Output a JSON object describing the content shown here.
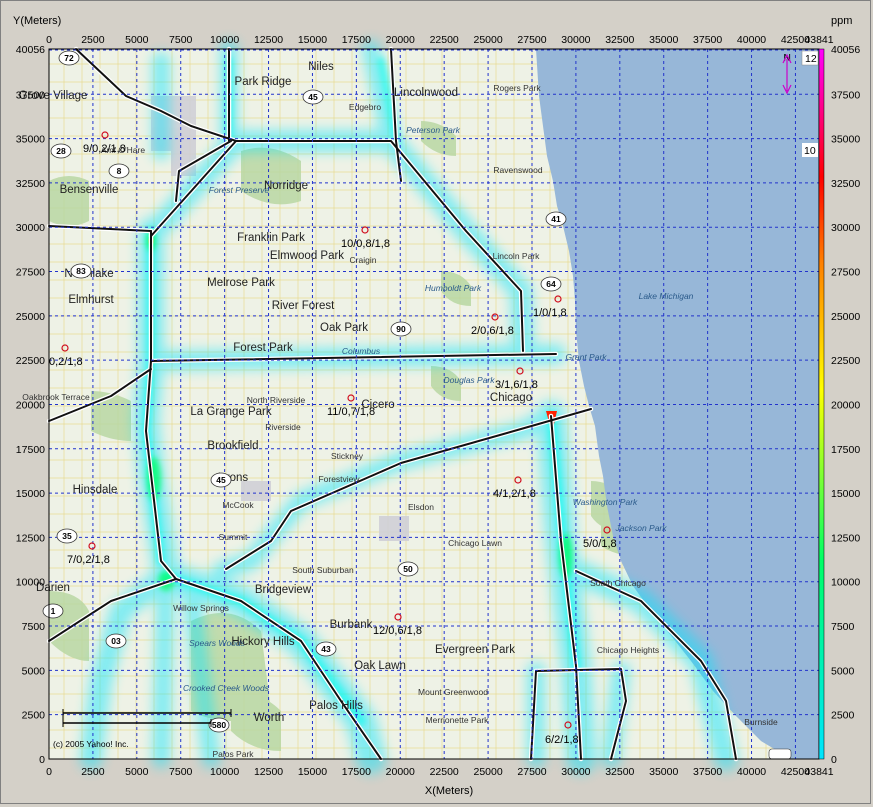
{
  "chart": {
    "y_title": "Y(Meters)",
    "x_title": "X(Meters)",
    "legend_unit": "ppm",
    "x_ticks": [
      "0",
      "2500",
      "5000",
      "7500",
      "10000",
      "12500",
      "15000",
      "17500",
      "20000",
      "22500",
      "25000",
      "27500",
      "30000",
      "32500",
      "35000",
      "37500",
      "40000",
      "42500"
    ],
    "x_end_tick": "43841",
    "y_ticks": [
      "40056",
      "37500",
      "35000",
      "32500",
      "30000",
      "27500",
      "25000",
      "22500",
      "20000",
      "17500",
      "15000",
      "12500",
      "10000",
      "7500",
      "5000",
      "2500",
      "0"
    ],
    "legend_ticks": [
      "40056",
      "37500",
      "35000",
      "32500",
      "30000",
      "27500",
      "25000",
      "22500",
      "20000",
      "17500",
      "15000",
      "12500",
      "10000",
      "7500",
      "5000",
      "2500",
      "0"
    ],
    "colors": {
      "grid": "#2233cc",
      "lake": "#97b7d8",
      "land": "#eef2e6",
      "highway": "#111111",
      "plume_low": "#00e5ff",
      "plume_mid": "#00ff66",
      "plume_high": "#ff2200"
    },
    "legend_colors": [
      "#00e5ff",
      "#00ff66",
      "#ffff00",
      "#ff7f00",
      "#ff0000",
      "#ff00ff"
    ]
  },
  "map_labels": [
    {
      "text": "Niles",
      "cls": "place"
    },
    {
      "text": "Park Ridge",
      "cls": "place"
    },
    {
      "text": "Lincolnwood",
      "cls": "place"
    },
    {
      "text": "Grove Village",
      "cls": "place"
    },
    {
      "text": "Rogers Park",
      "cls": "place-small"
    },
    {
      "text": "Edgebro",
      "cls": "place-small"
    },
    {
      "text": "Peterson Park",
      "cls": "place-italic"
    },
    {
      "text": "Amf O'Hare",
      "cls": "place-small"
    },
    {
      "text": "Bensenville",
      "cls": "place"
    },
    {
      "text": "Norridge",
      "cls": "place"
    },
    {
      "text": "Forest Preserve",
      "cls": "place-italic"
    },
    {
      "text": "Ravenswood",
      "cls": "place-small"
    },
    {
      "text": "Franklin Park",
      "cls": "place"
    },
    {
      "text": "Elmwood Park",
      "cls": "place"
    },
    {
      "text": "Craigin",
      "cls": "place-small"
    },
    {
      "text": "Lincoln Park",
      "cls": "place-small"
    },
    {
      "text": "Northlake",
      "cls": "place"
    },
    {
      "text": "Elmhurst",
      "cls": "place"
    },
    {
      "text": "Melrose Park",
      "cls": "place"
    },
    {
      "text": "River Forest",
      "cls": "place"
    },
    {
      "text": "Humboldt Park",
      "cls": "place-italic"
    },
    {
      "text": "Lake Michigan",
      "cls": "place-italic"
    },
    {
      "text": "Oak Park",
      "cls": "place"
    },
    {
      "text": "Forest Park",
      "cls": "place"
    },
    {
      "text": "Columbus",
      "cls": "place-italic"
    },
    {
      "text": "Grant Park",
      "cls": "place-italic"
    },
    {
      "text": "Douglas Park",
      "cls": "place-italic"
    },
    {
      "text": "Oakbrook Terrace",
      "cls": "place-small"
    },
    {
      "text": "La Grange Park",
      "cls": "place"
    },
    {
      "text": "North Riverside",
      "cls": "place-small"
    },
    {
      "text": "Riverside",
      "cls": "place-small"
    },
    {
      "text": "Cicero",
      "cls": "place"
    },
    {
      "text": "Chicago",
      "cls": "place"
    },
    {
      "text": "Brookfield",
      "cls": "place"
    },
    {
      "text": "Stickney",
      "cls": "place-small"
    },
    {
      "text": "Lyons",
      "cls": "place"
    },
    {
      "text": "Forestview",
      "cls": "place-small"
    },
    {
      "text": "Hinsdale",
      "cls": "place"
    },
    {
      "text": "McCook",
      "cls": "place-small"
    },
    {
      "text": "Elsdon",
      "cls": "place-small"
    },
    {
      "text": "Washington Park",
      "cls": "place-italic"
    },
    {
      "text": "Jackson Park",
      "cls": "place-italic"
    },
    {
      "text": "Summit",
      "cls": "place-small"
    },
    {
      "text": "Chicago Lawn",
      "cls": "place-small"
    },
    {
      "text": "South Suburban",
      "cls": "place-small"
    },
    {
      "text": "Darien",
      "cls": "place"
    },
    {
      "text": "Bridgeview",
      "cls": "place"
    },
    {
      "text": "South Chicago",
      "cls": "place-small"
    },
    {
      "text": "Willow Springs",
      "cls": "place-small"
    },
    {
      "text": "Burbank",
      "cls": "place"
    },
    {
      "text": "Spears Woods",
      "cls": "place-italic"
    },
    {
      "text": "Hickory Hills",
      "cls": "place"
    },
    {
      "text": "Evergreen Park",
      "cls": "place"
    },
    {
      "text": "Chicago Heights",
      "cls": "place-small"
    },
    {
      "text": "Oak Lawn",
      "cls": "place"
    },
    {
      "text": "Crooked Creek Woods",
      "cls": "place-italic"
    },
    {
      "text": "Mount Greenwood",
      "cls": "place-small"
    },
    {
      "text": "Worth",
      "cls": "place"
    },
    {
      "text": "Palos Hills",
      "cls": "place"
    },
    {
      "text": "Merrionette Park",
      "cls": "place-small"
    },
    {
      "text": "Palos Park",
      "cls": "place-small"
    },
    {
      "text": "Burnside",
      "cls": "place-small"
    }
  ],
  "receptors": [
    {
      "label": "9/0,2/1,8"
    },
    {
      "label": "10/0,8/1,8"
    },
    {
      "label": "1/0/1,8"
    },
    {
      "label": "2/0,6/1,8"
    },
    {
      "label": "0,2/1,8"
    },
    {
      "label": "3/1,6/1,8"
    },
    {
      "label": "11/0,7/1,8"
    },
    {
      "label": "4/1,2/1,8"
    },
    {
      "label": "5/0/1,8"
    },
    {
      "label": "7/0,2/1,8"
    },
    {
      "label": "12/0,6/1,8"
    },
    {
      "label": "6/2/1,8"
    }
  ],
  "shields": [
    "72",
    "45",
    "28",
    "8",
    "41",
    "83",
    "64",
    "90",
    "45",
    "50",
    "43",
    "03",
    "35",
    "1",
    "580"
  ],
  "north": {
    "label": "N",
    "scale_12": "12",
    "scale_10": "10"
  },
  "copyright": "(c) 2005 Yahoo! Inc."
}
